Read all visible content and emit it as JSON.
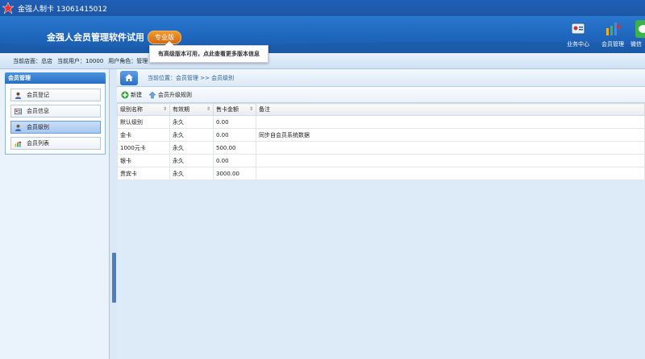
{
  "window": {
    "title": "金强人制卡 13061415012"
  },
  "header": {
    "app_title": "金强人会员管理软件试用",
    "edition_badge": "专业版",
    "nav": [
      {
        "label": "业务中心",
        "icon": "business-center-icon"
      },
      {
        "label": "会员管理",
        "icon": "member-management-icon"
      },
      {
        "label": "微信",
        "icon": "wechat-icon"
      }
    ]
  },
  "tooltip": {
    "text": "有高级版本可用，点此查看更多版本信息"
  },
  "infobar": {
    "store": "当前店面：总店",
    "user": "当前用户：10000",
    "role": "用户角色：管理"
  },
  "sidebar": {
    "title": "会员管理",
    "items": [
      {
        "label": "会员登记"
      },
      {
        "label": "会员信息"
      },
      {
        "label": "会员级别"
      },
      {
        "label": "会员列表"
      }
    ],
    "active_index": 2
  },
  "breadcrumb": {
    "text": "当前位置：会员管理 >> 会员级别"
  },
  "toolbar": {
    "new_label": "新建",
    "upgrade_rule_label": "会员升级规则"
  },
  "table": {
    "columns": [
      "级别名称",
      "有效期",
      "售卡金额",
      "备注"
    ],
    "rows": [
      [
        "默认级别",
        "永久",
        "0.00",
        ""
      ],
      [
        "金卡",
        "永久",
        "0.00",
        "同步自会员系统数据"
      ],
      [
        "1000元卡",
        "永久",
        "500.00",
        ""
      ],
      [
        "银卡",
        "永久",
        "0.00",
        ""
      ],
      [
        "贵宾卡",
        "永久",
        "3000.00",
        ""
      ]
    ]
  },
  "colors": {
    "header_blue": "#1f66bd",
    "badge_orange": "#e07f1f",
    "active_item": "#b6d2f4"
  }
}
